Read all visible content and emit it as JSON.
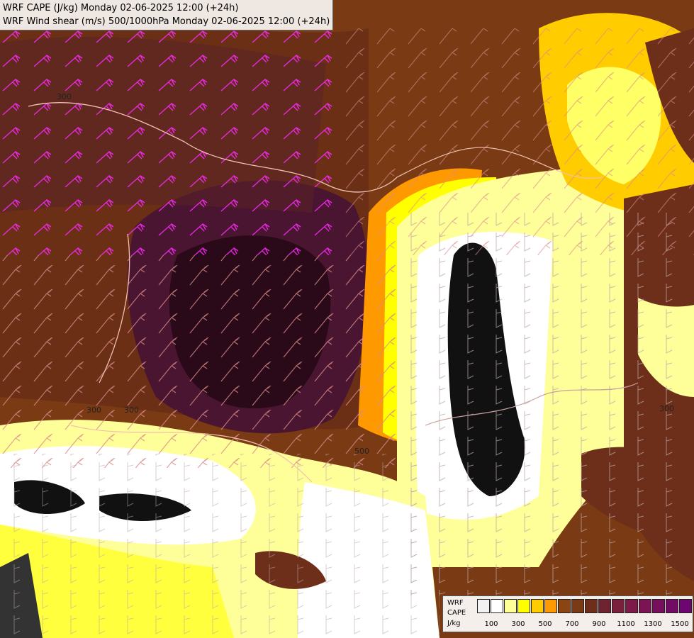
{
  "title": {
    "line1": "WRF CAPE (J/kg) Monday 02-06-2025 12:00 (+24h)",
    "line2": "WRF Wind shear (m/s) 500/1000hPa Monday 02-06-2025 12:00 (+24h)"
  },
  "legend": {
    "model": "WRF",
    "field": "CAPE",
    "unit": "J/kg",
    "colors": [
      "#f2f2f2",
      "#ffffff",
      "#ffff99",
      "#ffff00",
      "#ffcc00",
      "#ff9900",
      "#8b4513",
      "#7a3a14",
      "#6e2f1a",
      "#6e2330",
      "#7a1f3c",
      "#7d1a48",
      "#7a1454",
      "#780f5c",
      "#730a66",
      "#6e0570"
    ],
    "ticks": [
      "100",
      "300",
      "500",
      "700",
      "900",
      "1100",
      "1300",
      "1500"
    ]
  },
  "map_contour_labels": [
    "300",
    "300",
    "500",
    "300",
    "300"
  ]
}
